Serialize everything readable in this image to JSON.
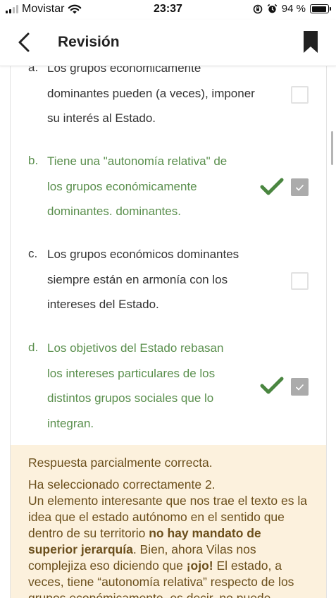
{
  "status_bar": {
    "carrier": "Movistar",
    "time": "23:37",
    "battery": "94 %",
    "battery_level": 0.94
  },
  "header": {
    "title": "Revisión",
    "back_icon": "chevron-left-icon",
    "bookmark_icon": "bookmark-icon"
  },
  "options": [
    {
      "letter": "a.",
      "lines": [
        "Los grupos económicamente",
        "dominantes pueden (a veces), imponer",
        "su interés al Estado."
      ],
      "checked": false,
      "correct": false
    },
    {
      "letter": "b.",
      "lines": [
        "Tiene una \"autonomía relativa\" de",
        "los grupos económicamente",
        "dominantes. dominantes."
      ],
      "checked": true,
      "correct": true
    },
    {
      "letter": "c.",
      "lines": [
        "Los grupos económicos dominantes",
        "siempre están en armonía con los",
        "intereses del Estado."
      ],
      "checked": false,
      "correct": false
    },
    {
      "letter": "d.",
      "lines": [
        "Los objetivos del Estado rebasan",
        "los intereses particulares de los",
        "distintos grupos sociales que lo",
        "integran."
      ],
      "checked": true,
      "correct": true
    }
  ],
  "feedback": {
    "status": "Respuesta parcialmente correcta.",
    "line1": "Ha seleccionado correctamente 2.",
    "p1": "Un elemento interesante que nos trae el texto es la idea que el estado autónomo en el sentido que dentro de su territorio ",
    "b1": "no hay mandato de superior jerarquía",
    "p2": ". Bien, ahora Vilas nos complejiza eso diciendo que ",
    "b2": "¡ojo!",
    "p3": " El estado, a veces, tiene “autonomía relativa” respecto de los grupos económicamente, es decir, no puede"
  },
  "colors": {
    "correct": "#5a8f4d",
    "feedback_bg": "#fcf1dd",
    "feedback_text": "#6b4f1c",
    "checked_box": "#ababab"
  }
}
